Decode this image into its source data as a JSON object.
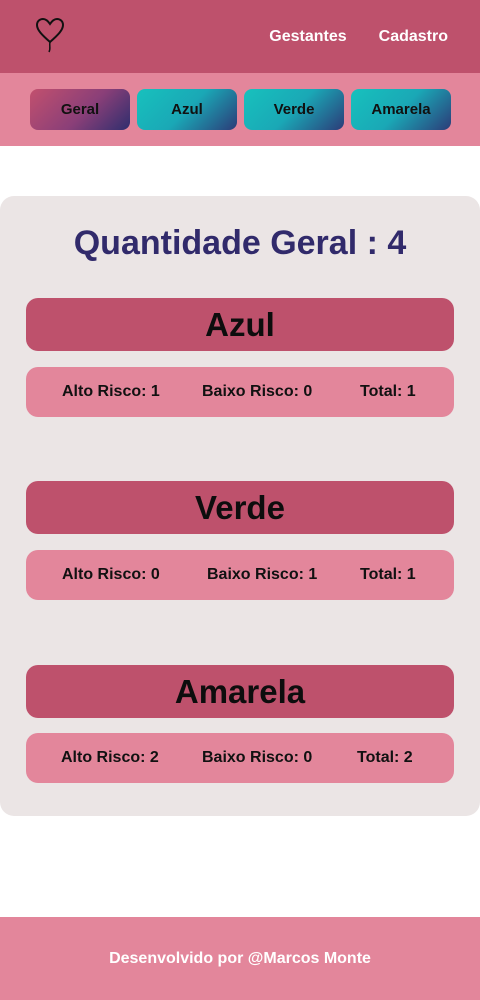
{
  "header": {
    "logo_icon": "heart-balloon-icon",
    "nav": [
      {
        "label": "Gestantes"
      },
      {
        "label": "Cadastro"
      }
    ]
  },
  "filters": [
    {
      "label": "Geral"
    },
    {
      "label": "Azul"
    },
    {
      "label": "Verde"
    },
    {
      "label": "Amarela"
    }
  ],
  "summary": {
    "title": "Quantidade Geral : 4"
  },
  "groups": [
    {
      "name": "Azul",
      "alto": "Alto Risco: 1",
      "baixo": "Baixo Risco: 0",
      "total": "Total: 1"
    },
    {
      "name": "Verde",
      "alto": "Alto Risco: 0",
      "baixo": "Baixo Risco: 1",
      "total": "Total: 1"
    },
    {
      "name": "Amarela",
      "alto": "Alto Risco: 2",
      "baixo": "Baixo Risco: 0",
      "total": "Total: 2"
    }
  ],
  "footer": {
    "text": "Desenvolvido por @Marcos Monte"
  },
  "colors": {
    "header": "#be516c",
    "accent_pink": "#e3869b",
    "card_bg": "#ebe5e5",
    "title_navy": "#312a6b",
    "teal": "#17c1bd"
  }
}
